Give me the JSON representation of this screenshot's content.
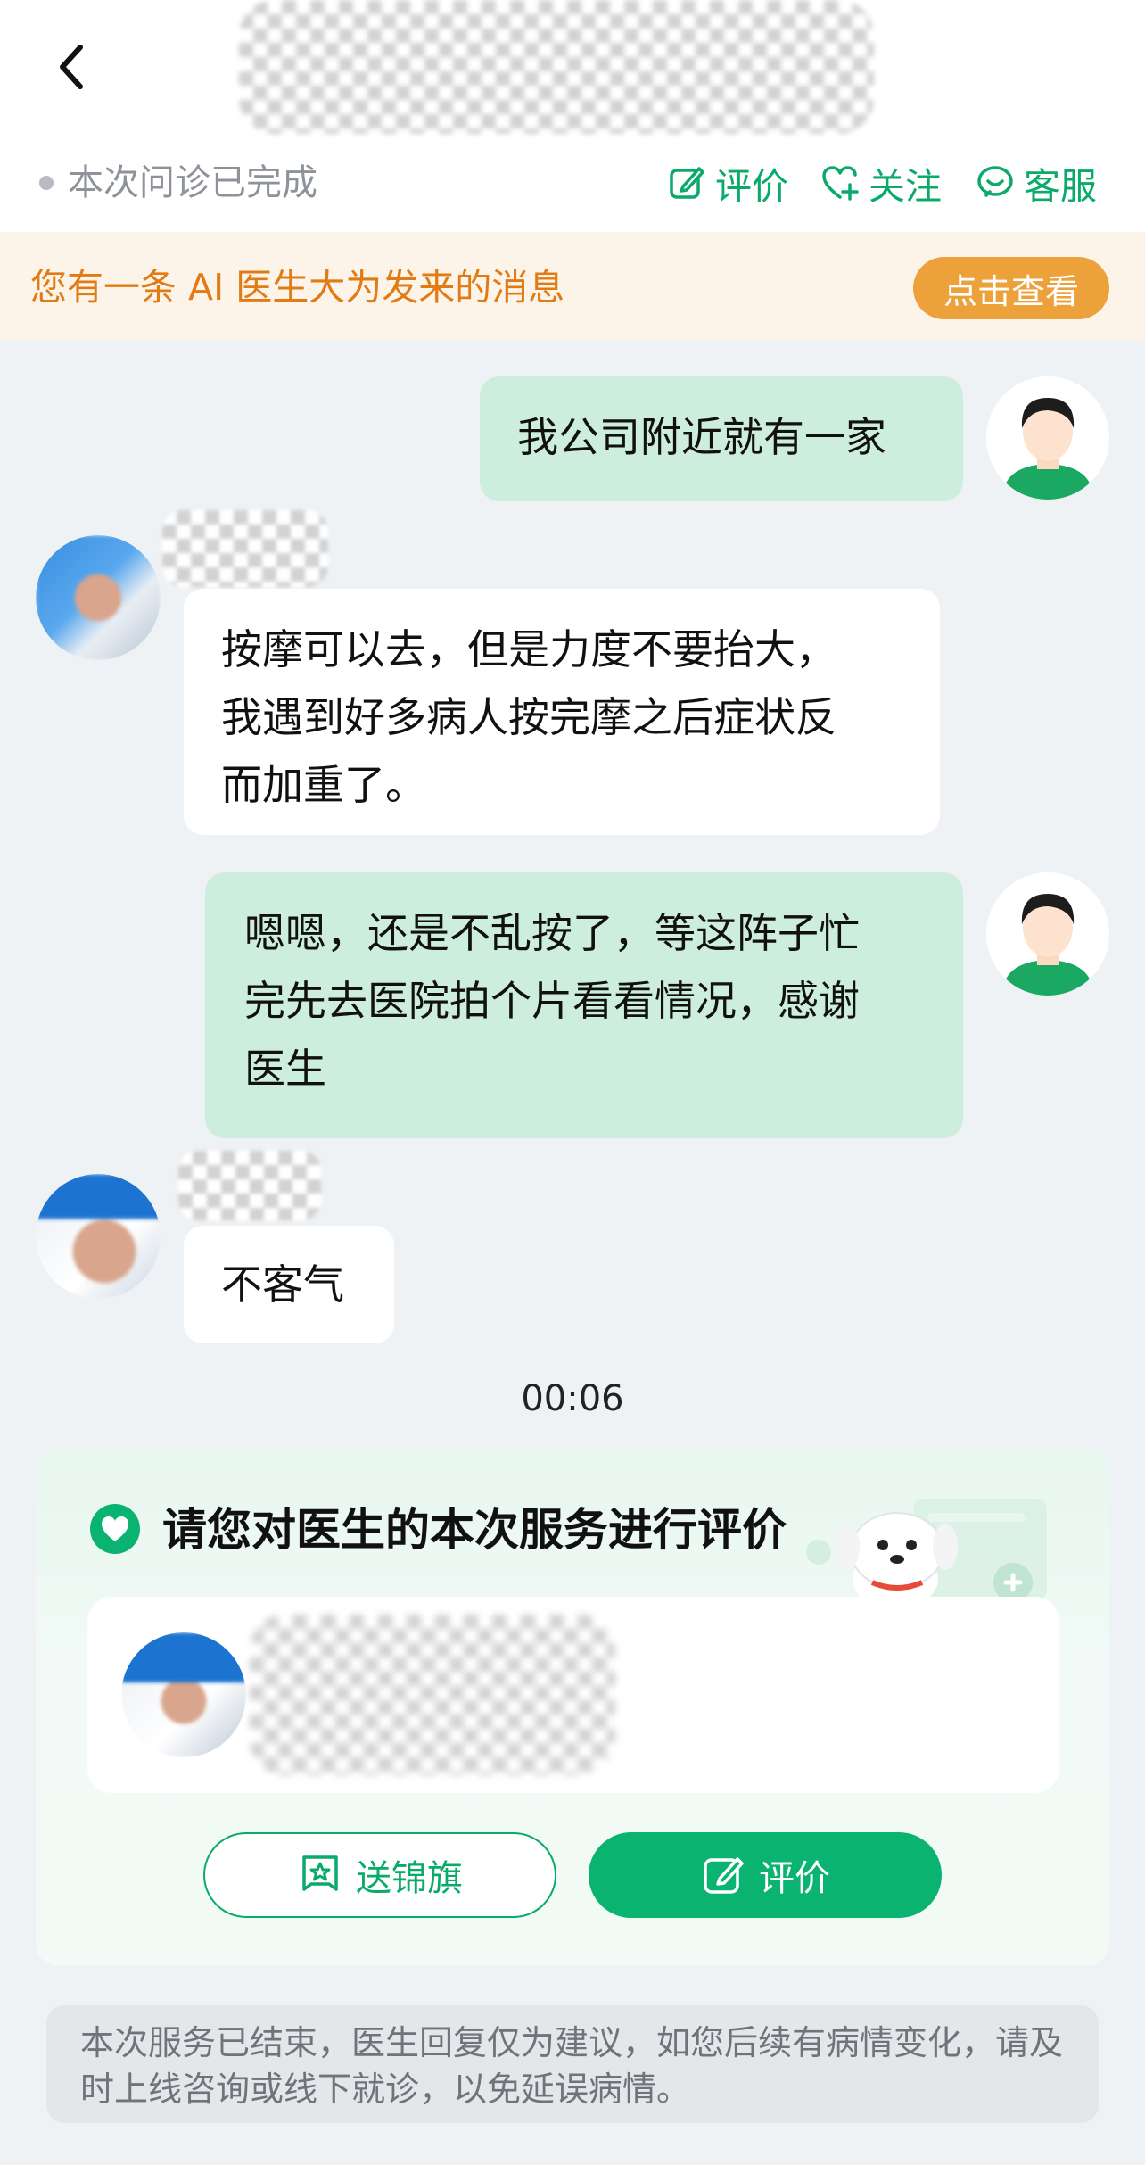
{
  "header": {
    "back_icon": "chevron-left-icon"
  },
  "status": {
    "text": "本次问诊已完成"
  },
  "actions": [
    {
      "label": "评价",
      "icon": "edit-icon"
    },
    {
      "label": "关注",
      "icon": "heart-plus-icon"
    },
    {
      "label": "客服",
      "icon": "service-icon"
    }
  ],
  "notice": {
    "text": "您有一条 AI 医生大为发来的消息",
    "button": "点击查看"
  },
  "messages": [
    {
      "from": "patient",
      "text": "我公司附近就有一家"
    },
    {
      "from": "doctor",
      "lines": [
        "按摩可以去，但是力度不要抬大，",
        "我遇到好多病人按完摩之后症状反",
        "而加重了。"
      ]
    },
    {
      "from": "patient",
      "lines": [
        "嗯嗯，还是不乱按了，等这阵子忙",
        "完先去医院拍个片看看情况，感谢",
        "医生"
      ]
    },
    {
      "from": "doctor",
      "text": "不客气"
    }
  ],
  "timestamp": "00:06",
  "rating_card": {
    "title": "请您对医生的本次服务进行评价",
    "flag_button": "送锦旗",
    "rate_button": "评价"
  },
  "disclaimer": "本次服务已结束，医生回复仅为建议，如您后续有病情变化，请及时上线咨询或线下就诊，以免延误病情。",
  "colors": {
    "accent_green": "#0aaa6a",
    "patient_bubble": "#cdeedc",
    "notice_orange": "#e07b15",
    "notice_button": "#eca13a"
  }
}
